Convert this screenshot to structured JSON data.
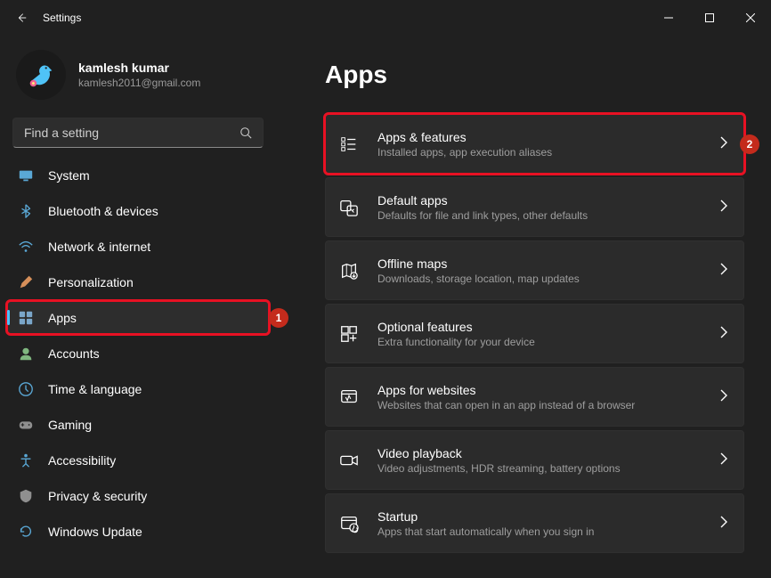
{
  "window": {
    "title": "Settings"
  },
  "profile": {
    "name": "kamlesh kumar",
    "email": "kamlesh2011@gmail.com"
  },
  "search": {
    "placeholder": "Find a setting"
  },
  "sidebar": {
    "items": [
      {
        "label": "System",
        "icon": "system-icon",
        "color": "#5aa8d6"
      },
      {
        "label": "Bluetooth & devices",
        "icon": "bluetooth-icon",
        "color": "#5aa8d6"
      },
      {
        "label": "Network & internet",
        "icon": "network-icon",
        "color": "#5aa8d6"
      },
      {
        "label": "Personalization",
        "icon": "personalization-icon",
        "color": "#d68f5a"
      },
      {
        "label": "Apps",
        "icon": "apps-icon",
        "color": "#7aa6c9",
        "selected": true,
        "highlight": true,
        "step": "1"
      },
      {
        "label": "Accounts",
        "icon": "accounts-icon",
        "color": "#7fb77f"
      },
      {
        "label": "Time & language",
        "icon": "time-icon",
        "color": "#5aa8d6"
      },
      {
        "label": "Gaming",
        "icon": "gaming-icon",
        "color": "#8f8f8f"
      },
      {
        "label": "Accessibility",
        "icon": "accessibility-icon",
        "color": "#5aa8d6"
      },
      {
        "label": "Privacy & security",
        "icon": "privacy-icon",
        "color": "#8f8f8f"
      },
      {
        "label": "Windows Update",
        "icon": "update-icon",
        "color": "#5aa8d6"
      }
    ]
  },
  "main": {
    "heading": "Apps",
    "cards": [
      {
        "title": "Apps & features",
        "sub": "Installed apps, app execution aliases",
        "icon": "apps-features-icon",
        "highlight": true,
        "step": "2"
      },
      {
        "title": "Default apps",
        "sub": "Defaults for file and link types, other defaults",
        "icon": "default-apps-icon"
      },
      {
        "title": "Offline maps",
        "sub": "Downloads, storage location, map updates",
        "icon": "offline-maps-icon"
      },
      {
        "title": "Optional features",
        "sub": "Extra functionality for your device",
        "icon": "optional-features-icon"
      },
      {
        "title": "Apps for websites",
        "sub": "Websites that can open in an app instead of a browser",
        "icon": "apps-websites-icon"
      },
      {
        "title": "Video playback",
        "sub": "Video adjustments, HDR streaming, battery options",
        "icon": "video-playback-icon"
      },
      {
        "title": "Startup",
        "sub": "Apps that start automatically when you sign in",
        "icon": "startup-icon"
      }
    ]
  }
}
